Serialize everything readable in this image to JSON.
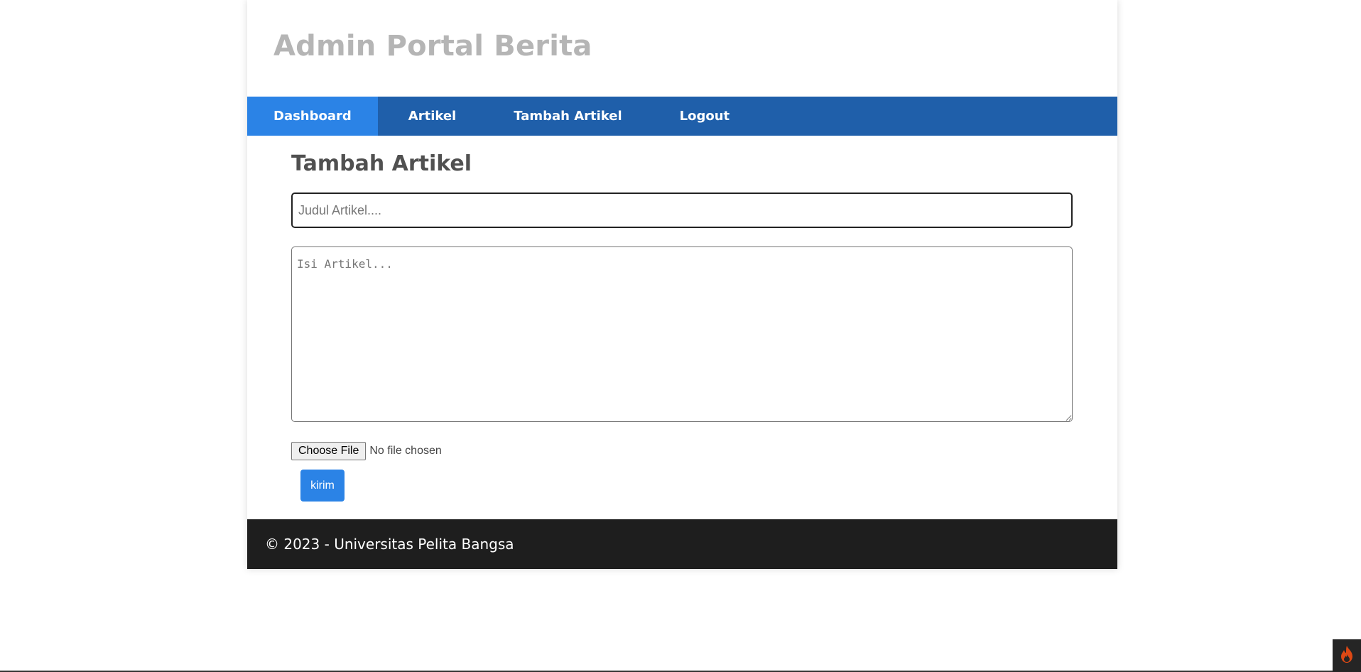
{
  "header": {
    "site_title": "Admin Portal Berita"
  },
  "nav": {
    "items": [
      {
        "label": "Dashboard",
        "active": true
      },
      {
        "label": "Artikel",
        "active": false
      },
      {
        "label": "Tambah Artikel",
        "active": false
      },
      {
        "label": "Logout",
        "active": false
      }
    ]
  },
  "form": {
    "heading": "Tambah Artikel",
    "title_placeholder": "Judul Artikel....",
    "title_value": "",
    "body_placeholder": "Isi Artikel...",
    "body_value": "",
    "file_button_label": "Choose File",
    "file_status": "No file chosen",
    "submit_label": "kirim"
  },
  "footer": {
    "text": "© 2023 - Universitas Pelita Bangsa"
  },
  "icons": {
    "debug_toolbar": "flame-icon"
  },
  "colors": {
    "nav_bg": "#1f5faa",
    "nav_active": "#2b83e6",
    "button": "#2b83e6",
    "footer_bg": "#1e1e1e",
    "title_gray": "#b5b5b5",
    "flame": "#dd4814"
  }
}
